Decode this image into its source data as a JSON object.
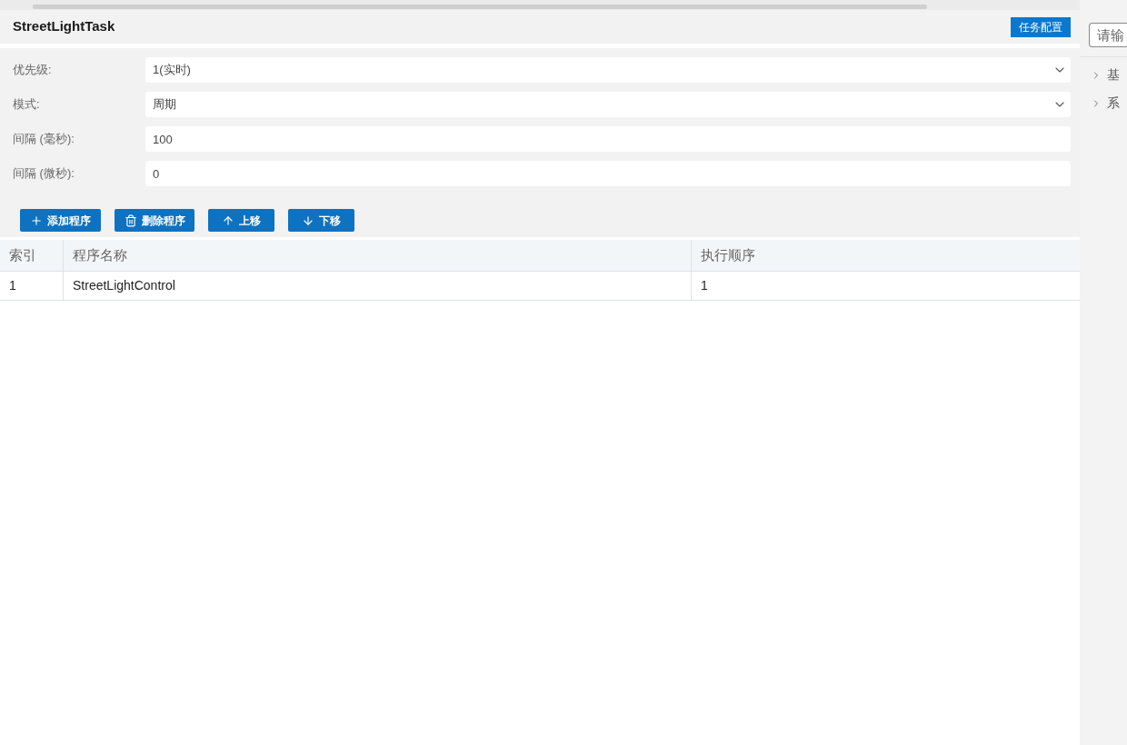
{
  "header": {
    "title": "StreetLightTask",
    "config_button": "任务配置"
  },
  "form": {
    "fields": [
      {
        "kind": "select",
        "label": "优先级:",
        "value": "1(实时)"
      },
      {
        "kind": "select",
        "label": "模式:",
        "value": "周期"
      },
      {
        "kind": "input",
        "label": "间隔 (毫秒):",
        "value": "100"
      },
      {
        "kind": "input",
        "label": "间隔 (微秒):",
        "value": "0"
      }
    ]
  },
  "toolbar": {
    "buttons": [
      {
        "kind": "add",
        "label": "添加程序"
      },
      {
        "kind": "delete",
        "label": "删除程序"
      },
      {
        "kind": "up",
        "label": "上移"
      },
      {
        "kind": "down",
        "label": "下移"
      }
    ]
  },
  "table": {
    "columns": [
      "索引",
      "程序名称",
      "执行顺序"
    ],
    "rows": [
      [
        "1",
        "StreetLightControl",
        "1"
      ]
    ]
  },
  "sidebar": {
    "search": {
      "placeholder": "请输"
    },
    "tree": [
      {
        "label": "基",
        "expanded": false
      },
      {
        "label": "系",
        "expanded": false
      }
    ]
  }
}
